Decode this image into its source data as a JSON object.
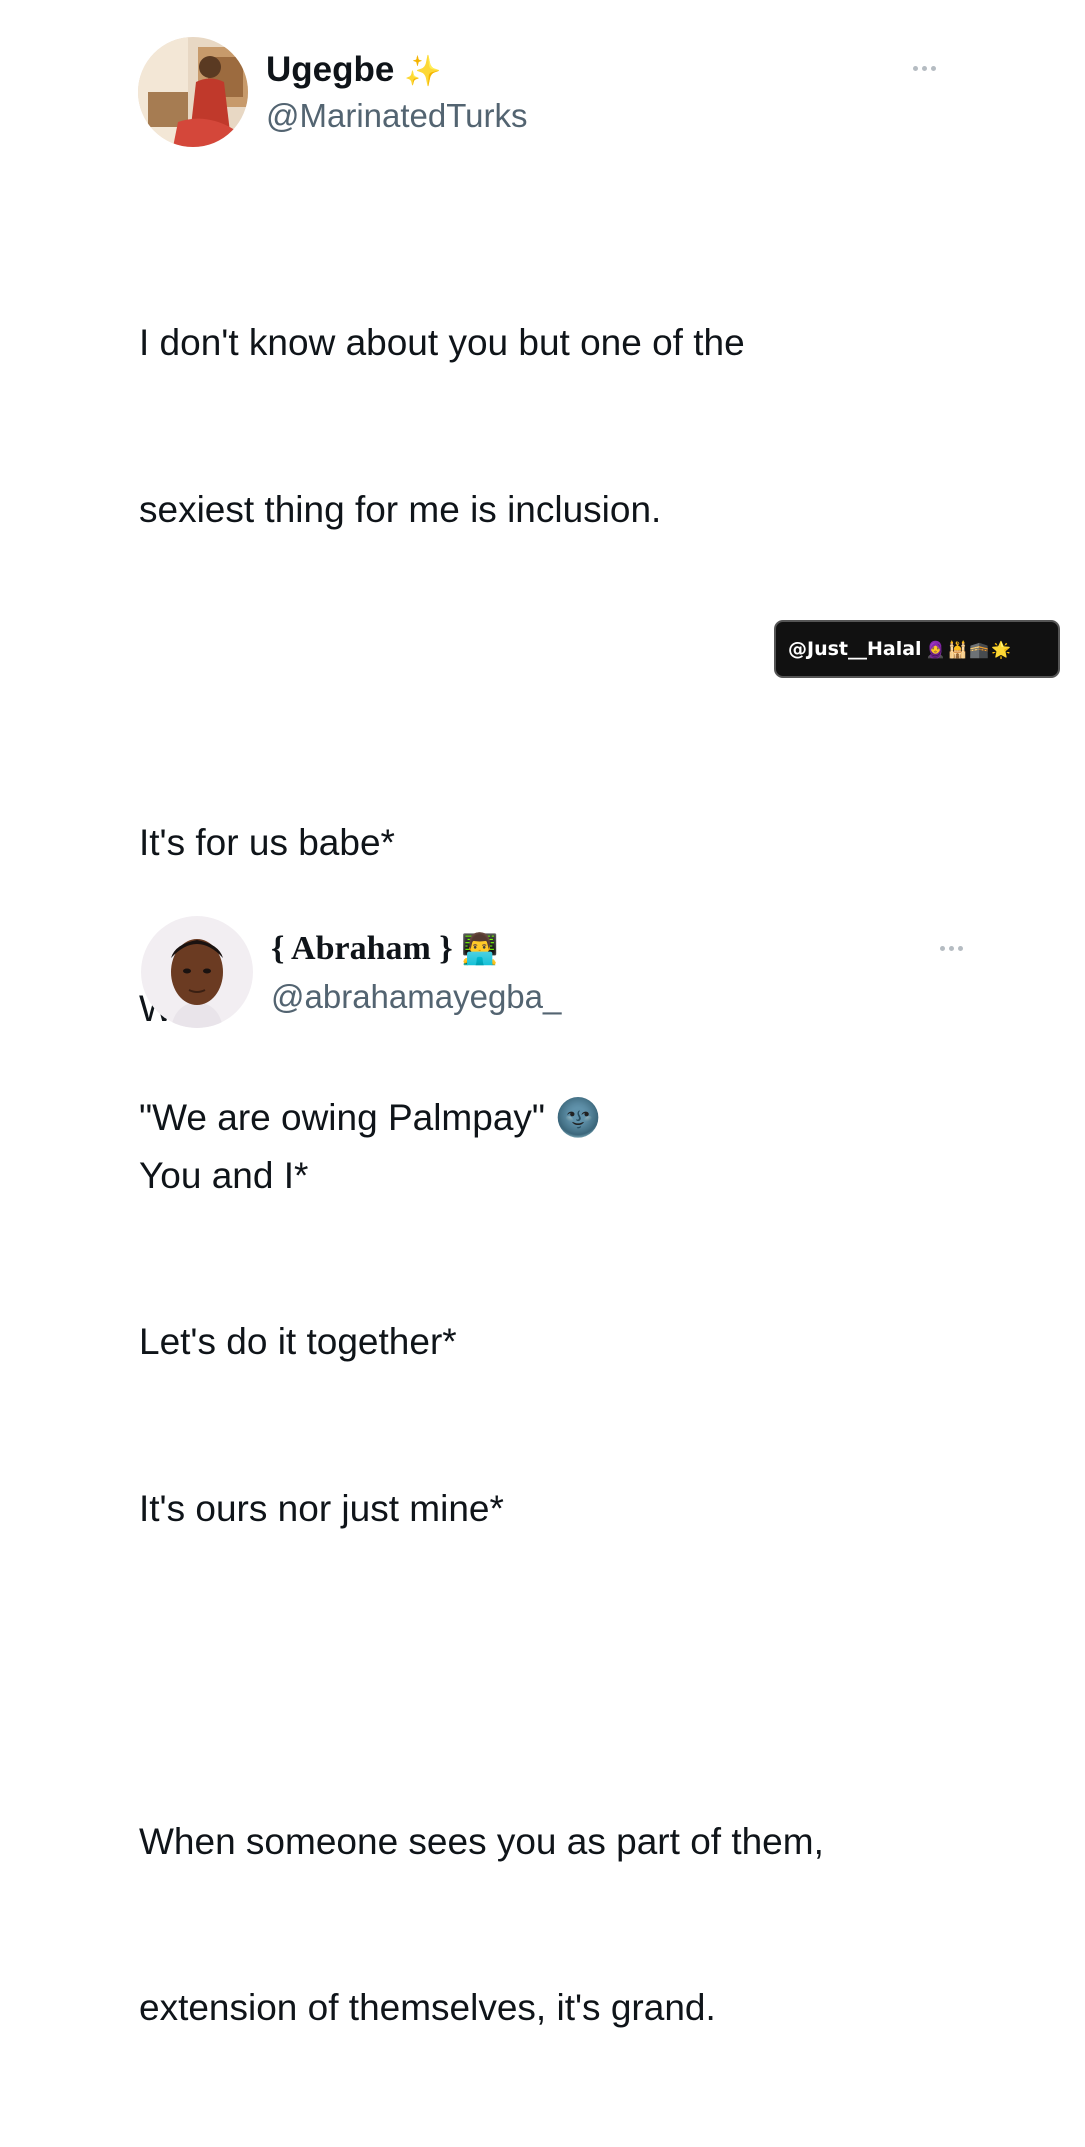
{
  "tweet1": {
    "name": "Ugegbe",
    "name_emoji": "✨",
    "handle": "@MarinatedTurks",
    "lines": [
      "I don't know about you but one of the",
      "sexiest thing for me is inclusion.",
      "",
      "It's for us babe*",
      "We*",
      "You and I*",
      "Let's do it together*",
      "It's ours nor just mine*",
      "",
      "When someone sees you as part of them,",
      "extension of themselves, it's grand."
    ]
  },
  "tweet2": {
    "name": "{ Abraham }",
    "name_emoji": "👨‍💻",
    "handle": "@abrahamayegba_",
    "text": "\"We are owing Palmpay\" 🌚"
  },
  "watermark": {
    "text": "@Just__Halal",
    "icons": [
      "🧕",
      "🕌",
      "🕋",
      "🌟"
    ]
  },
  "colors": {
    "text": "#0f1419",
    "handle": "#536471",
    "watermark_bg": "#111111"
  },
  "icons": {
    "more": "more-horizontal-icon"
  }
}
